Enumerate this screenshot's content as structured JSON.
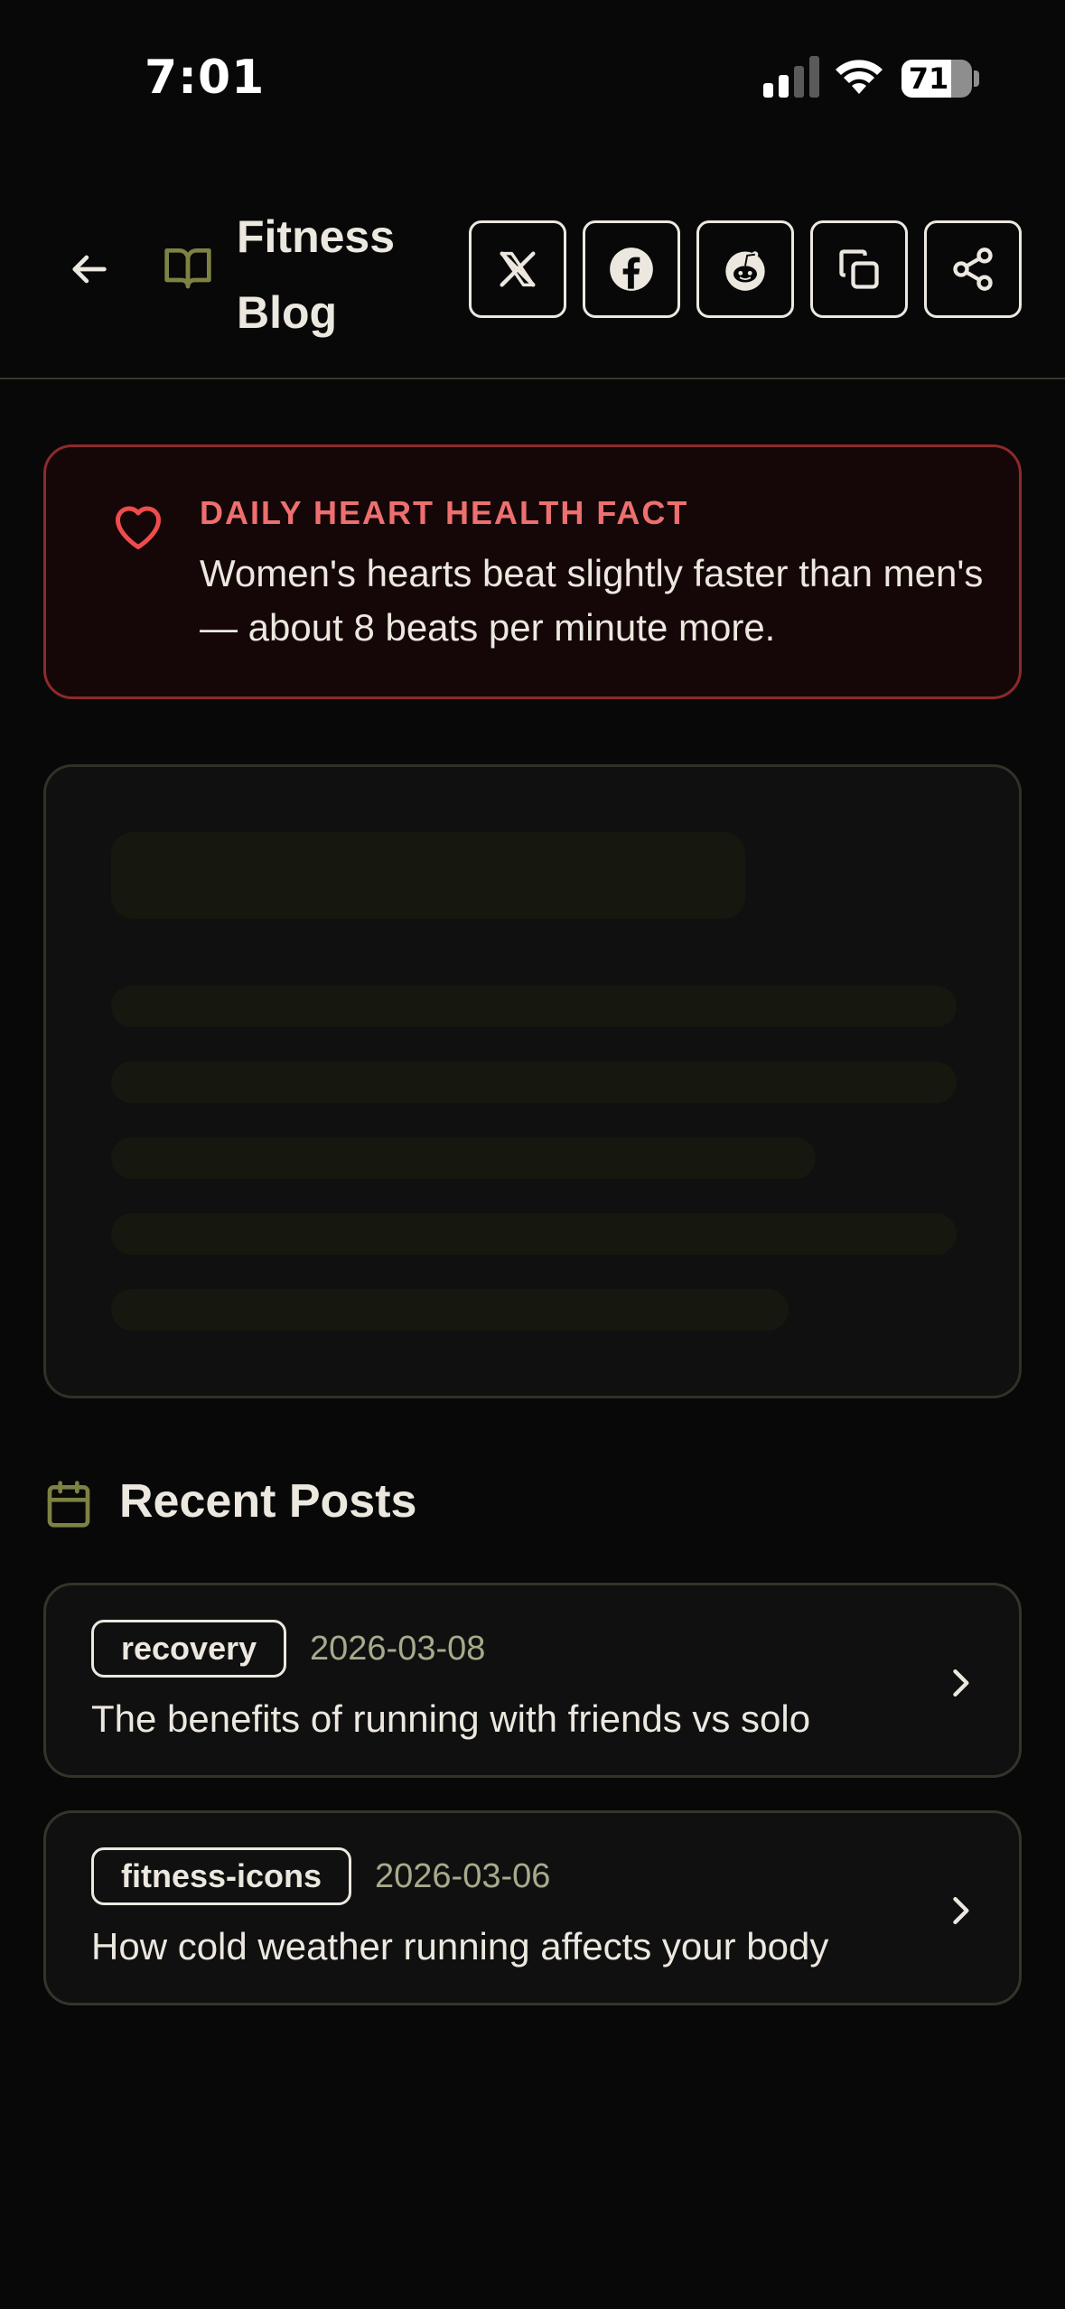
{
  "status_bar": {
    "time": "7:01",
    "battery_level": "71",
    "battery_fraction": 0.71
  },
  "header": {
    "title_line1": "Fitness",
    "title_line2": "Blog",
    "share_buttons": [
      "x-icon",
      "facebook-icon",
      "reddit-icon",
      "copy-icon",
      "share-icon"
    ]
  },
  "fact": {
    "label": "DAILY HEART HEALTH FACT",
    "text": "Women's hearts beat slightly faster than men's — about 8 beats per minute more.",
    "accent_color": "#ee6f6f"
  },
  "recent": {
    "title": "Recent Posts",
    "posts": [
      {
        "tag": "recovery",
        "date": "2026-03-08",
        "title": "The benefits of running with friends vs solo"
      },
      {
        "tag": "fitness-icons",
        "date": "2026-03-06",
        "title": "How cold weather running affects your body"
      }
    ]
  },
  "colors": {
    "background": "#080808",
    "text": "#ece8df",
    "olive_accent": "#7d8244",
    "date_text": "#a8aa8c"
  }
}
